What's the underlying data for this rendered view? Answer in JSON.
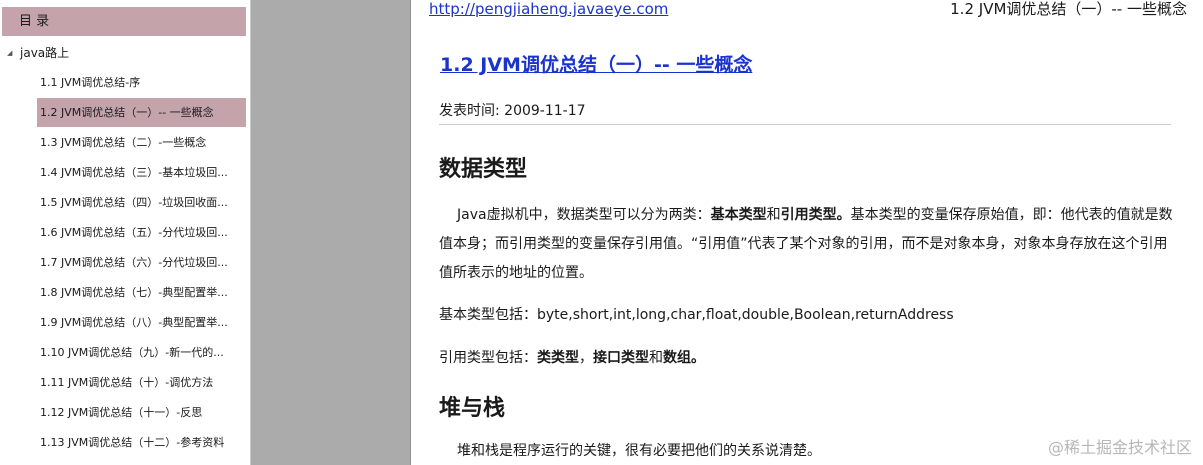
{
  "toc": {
    "header": "目 录",
    "root": {
      "caret": "◢",
      "label": "java路上"
    },
    "items": [
      {
        "label": "1.1 JVM调优总结-序"
      },
      {
        "label": "1.2 JVM调优总结（一）-- 一些概念"
      },
      {
        "label": "1.3 JVM调优总结（二）-一些概念"
      },
      {
        "label": "1.4 JVM调优总结（三）-基本垃圾回..."
      },
      {
        "label": "1.5 JVM调优总结（四）-垃圾回收面..."
      },
      {
        "label": "1.6 JVM调优总结（五）-分代垃圾回..."
      },
      {
        "label": "1.7 JVM调优总结（六）-分代垃圾回..."
      },
      {
        "label": "1.8 JVM调优总结（七）-典型配置举..."
      },
      {
        "label": "1.9 JVM调优总结（八）-典型配置举..."
      },
      {
        "label": "1.10 JVM调优总结（九）-新一代的..."
      },
      {
        "label": "1.11 JVM调优总结（十）-调优方法"
      },
      {
        "label": "1.12 JVM调优总结（十一）-反思"
      },
      {
        "label": "1.13 JVM调优总结（十二）-参考资料"
      }
    ],
    "active_index": 1
  },
  "page": {
    "header_url": "http://pengjiaheng.javaeye.com",
    "running_title": "1.2 JVM调优总结（一）-- 一些概念",
    "title": "1.2 JVM调优总结（一）-- 一些概念",
    "pub_time": "发表时间: 2009-11-17",
    "sections": {
      "data_types": {
        "heading": "数据类型",
        "para": {
          "t1": "Java虚拟机中，数据类型可以分为两类：",
          "b1": "基本类型",
          "t2": "和",
          "b2": "引用类型。",
          "t3": "基本类型的变量保存原始值，即：他代表的值就是数值本身；而引用类型的变量保存引用值。“引用值”代表了某个对象的引用，而不是对象本身，对象本身存放在这个引用值所表示的地址的位置。"
        },
        "basic_types": "基本类型包括：byte,short,int,long,char,float,double,Boolean,returnAddress",
        "ref_types": {
          "prefix": "引用类型包括：",
          "b1": "类类型",
          "sep1": "，",
          "b2": "接口类型",
          "t2": "和",
          "b3": "数组。"
        }
      },
      "heap_stack": {
        "heading": "堆与栈",
        "para": "堆和栈是程序运行的关键，很有必要把他们的关系说清楚。"
      }
    }
  },
  "watermark": "@稀土掘金技术社区"
}
